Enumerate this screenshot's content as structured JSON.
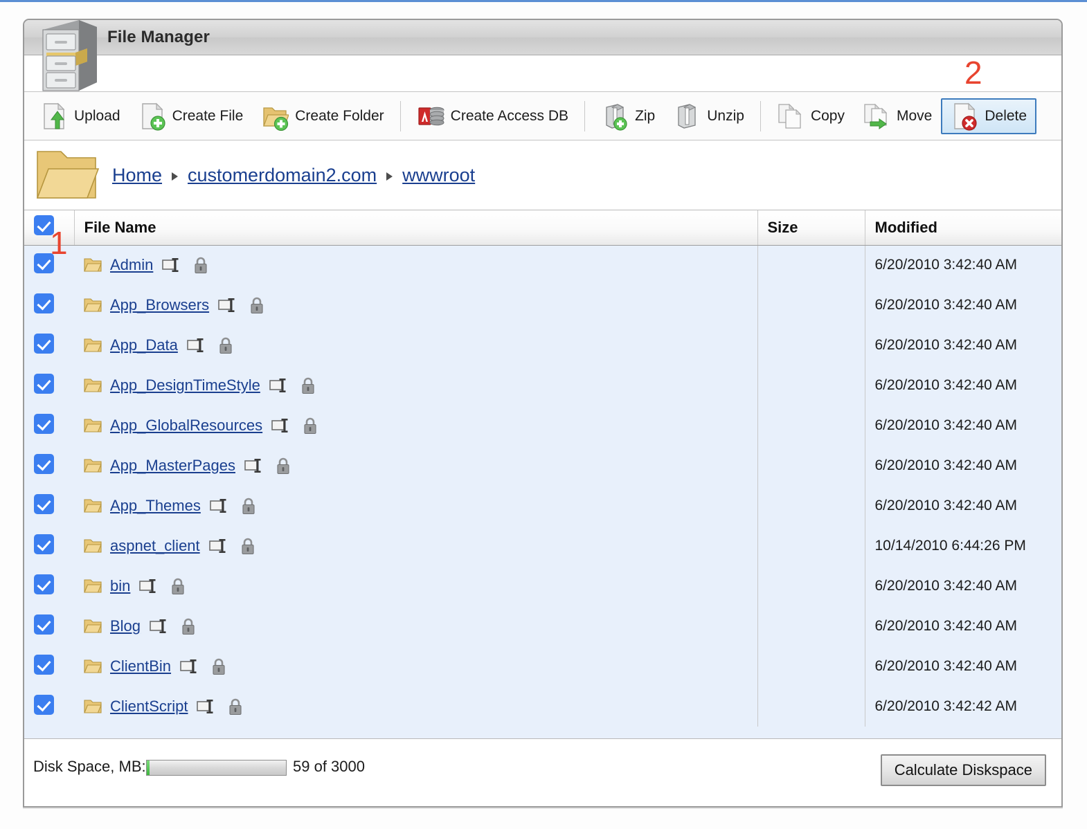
{
  "window": {
    "title": "File Manager",
    "cabinet_icon": "file-cabinet-icon"
  },
  "annotations": [
    {
      "label": "1",
      "target": "select-all-checkbox"
    },
    {
      "label": "2",
      "target": "delete-button"
    }
  ],
  "toolbar": {
    "buttons": [
      {
        "label": "Upload",
        "icon": "upload-file-icon",
        "active": false
      },
      {
        "label": "Create File",
        "icon": "new-file-icon",
        "active": false
      },
      {
        "label": "Create Folder",
        "icon": "new-folder-icon",
        "active": false
      },
      {
        "label": "Create Access DB",
        "icon": "access-database-icon",
        "active": false
      },
      {
        "label": "Zip",
        "icon": "zip-add-icon",
        "active": false
      },
      {
        "label": "Unzip",
        "icon": "unzip-icon",
        "active": false
      },
      {
        "label": "Copy",
        "icon": "copy-files-icon",
        "active": false
      },
      {
        "label": "Move",
        "icon": "move-files-icon",
        "active": false
      },
      {
        "label": "Delete",
        "icon": "delete-file-icon",
        "active": true
      }
    ],
    "active_accent": "#3d7bbd"
  },
  "breadcrumb": {
    "folder_icon": "open-folder-icon",
    "items": [
      {
        "label": "Home"
      },
      {
        "label": "customerdomain2.com"
      },
      {
        "label": "wwwroot"
      }
    ],
    "link_color": "#1a3f8f"
  },
  "table": {
    "select_all_checked": true,
    "columns": [
      {
        "key": "check",
        "label": ""
      },
      {
        "key": "name",
        "label": "File Name"
      },
      {
        "key": "size",
        "label": "Size"
      },
      {
        "key": "modified",
        "label": "Modified"
      }
    ],
    "rows": [
      {
        "checked": true,
        "name": "Admin",
        "size": "",
        "modified": "6/20/2010 3:42:40 AM"
      },
      {
        "checked": true,
        "name": "App_Browsers",
        "size": "",
        "modified": "6/20/2010 3:42:40 AM"
      },
      {
        "checked": true,
        "name": "App_Data",
        "size": "",
        "modified": "6/20/2010 3:42:40 AM"
      },
      {
        "checked": true,
        "name": "App_DesignTimeStyle",
        "size": "",
        "modified": "6/20/2010 3:42:40 AM"
      },
      {
        "checked": true,
        "name": "App_GlobalResources",
        "size": "",
        "modified": "6/20/2010 3:42:40 AM"
      },
      {
        "checked": true,
        "name": "App_MasterPages",
        "size": "",
        "modified": "6/20/2010 3:42:40 AM"
      },
      {
        "checked": true,
        "name": "App_Themes",
        "size": "",
        "modified": "6/20/2010 3:42:40 AM"
      },
      {
        "checked": true,
        "name": "aspnet_client",
        "size": "",
        "modified": "10/14/2010 6:44:26 PM"
      },
      {
        "checked": true,
        "name": "bin",
        "size": "",
        "modified": "6/20/2010 3:42:40 AM"
      },
      {
        "checked": true,
        "name": "Blog",
        "size": "",
        "modified": "6/20/2010 3:42:40 AM"
      },
      {
        "checked": true,
        "name": "ClientBin",
        "size": "",
        "modified": "6/20/2010 3:42:40 AM"
      },
      {
        "checked": true,
        "name": "ClientScript",
        "size": "",
        "modified": "6/20/2010 3:42:42 AM"
      }
    ],
    "row_icons": {
      "folder": "folder-icon",
      "rename": "rename-icon",
      "permissions": "lock-icon"
    },
    "row_background": "#e8f0fb",
    "checkbox_color": "#3b7ef0"
  },
  "footer": {
    "disk_label": "Disk Space, MB:",
    "disk_usage_text": "59 of 3000",
    "disk_used_mb": 59,
    "disk_total_mb": 3000,
    "disk_percent": 2,
    "calculate_button": "Calculate Diskspace"
  }
}
